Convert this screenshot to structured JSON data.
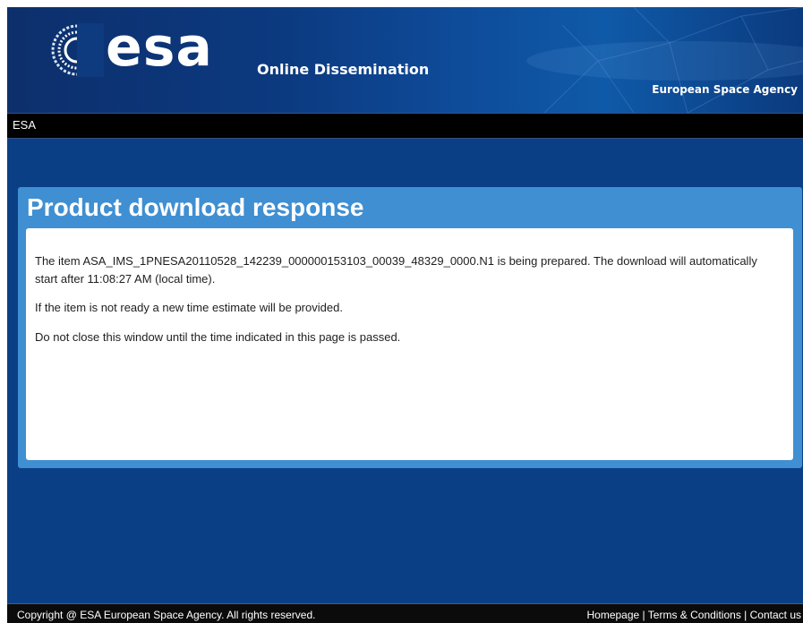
{
  "header": {
    "logo_text": "esa",
    "subtitle": "Online Dissemination",
    "agency": "European Space Agency"
  },
  "nav": {
    "label": "ESA"
  },
  "panel": {
    "title": "Product download response",
    "paragraphs": [
      "The item ASA_IMS_1PNESA20110528_142239_000000153103_00039_48329_0000.N1 is being prepared. The download will automatically start after 11:08:27 AM (local time).",
      "If the item is not ready a new time estimate will be provided.",
      "Do not close this window until the time indicated in this page is passed."
    ]
  },
  "footer": {
    "copyright": "Copyright @ ESA European Space Agency. All rights reserved.",
    "links": [
      "Homepage",
      "Terms & Conditions",
      "Contact us"
    ],
    "separator": " | "
  },
  "colors": {
    "page_bg": "#0a3f86",
    "panel_bg": "#3f8fd2",
    "navbar_bg": "#000000",
    "footer_bg": "#0b0b0b"
  }
}
